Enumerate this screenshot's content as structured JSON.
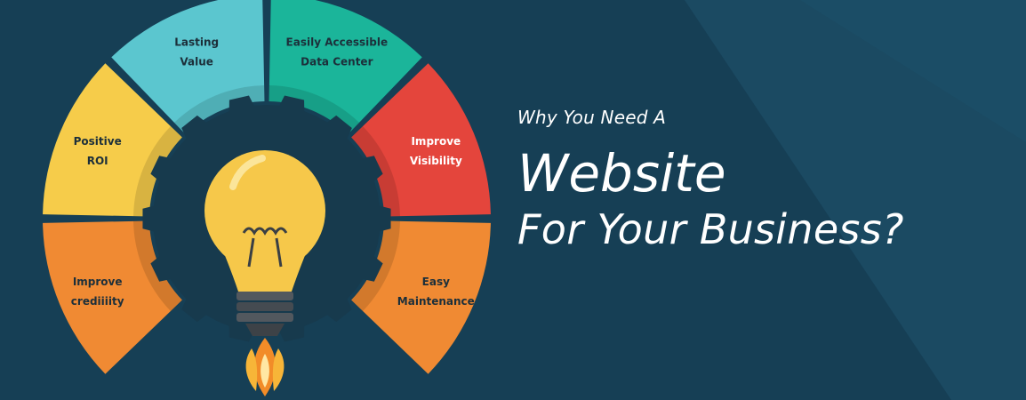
{
  "banner": {
    "kicker": "Why You Need A",
    "headline_main": "Website",
    "headline_sub": "For Your Business?"
  },
  "segments": [
    {
      "id": "improve-credibility",
      "line1": "Improve",
      "line2": "crediiiity",
      "color": "#f08a33"
    },
    {
      "id": "positive-roi",
      "line1": "Positive",
      "line2": "ROI",
      "color": "#f6cc4a"
    },
    {
      "id": "lasting-value",
      "line1": "Lasting",
      "line2": "Value",
      "color": "#5bc6cf"
    },
    {
      "id": "easily-accessible",
      "line1": "Easily Accessible",
      "line2": "Data Center",
      "color": "#1bb59a"
    },
    {
      "id": "improve-visibility",
      "line1": "Improve",
      "line2": "Visibility",
      "color": "#e4453c"
    },
    {
      "id": "easy-maintenance",
      "line1": "Easy",
      "line2": "Maintenance",
      "color": "#f08a33"
    }
  ],
  "colors": {
    "background": "#163f55",
    "background_panel": "#1a4b63",
    "bulb_glass": "#f6c84a",
    "bulb_base": "#4a4f55",
    "flame": "#f28c28"
  }
}
